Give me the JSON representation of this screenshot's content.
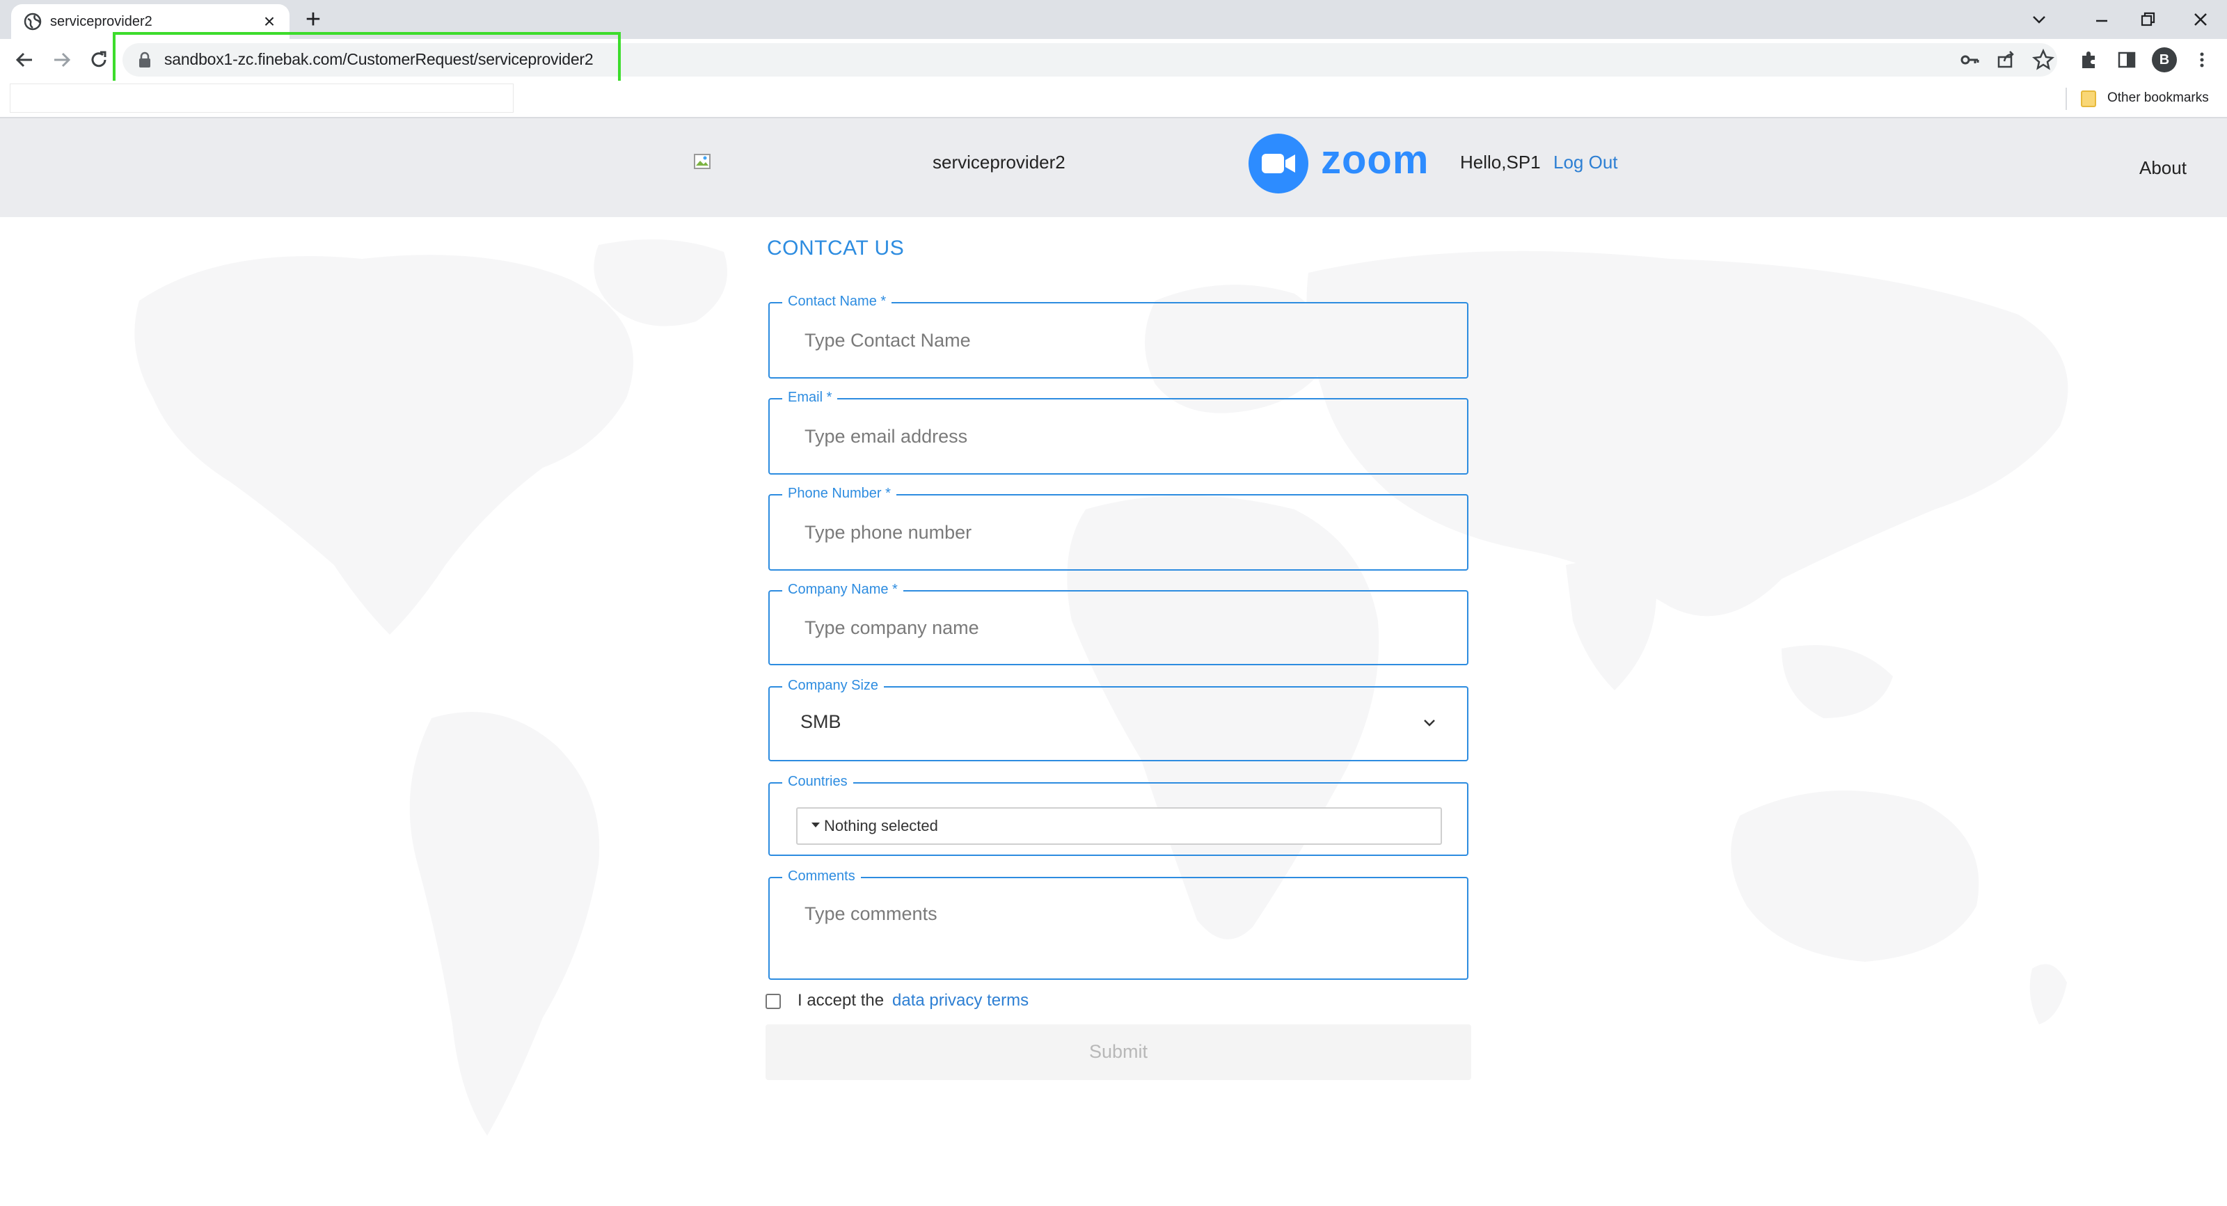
{
  "browser": {
    "tab_title": "serviceprovider2",
    "tab_close": "×",
    "new_tab": "+",
    "url": "sandbox1-zc.finebak.com/CustomerRequest/serviceprovider2",
    "other_bookmarks": "Other bookmarks",
    "profile_initial": "B",
    "highlight_color": "#3ddc2c"
  },
  "header": {
    "site_name": "serviceprovider2",
    "brand": "zoom",
    "greeting": "Hello,SP1",
    "logout": "Log Out",
    "about": "About",
    "brand_color": "#2d8cff"
  },
  "form": {
    "title": "CONTCAT US",
    "accent_color": "#2d8ce0",
    "fields": {
      "contact_name": {
        "label": "Contact Name *",
        "placeholder": "Type Contact Name"
      },
      "email": {
        "label": "Email *",
        "placeholder": "Type email address"
      },
      "phone": {
        "label": "Phone Number *",
        "placeholder": "Type phone number"
      },
      "company_name": {
        "label": "Company Name *",
        "placeholder": "Type company name"
      },
      "company_size": {
        "label": "Company Size",
        "value": "SMB"
      },
      "countries": {
        "label": "Countries",
        "value": "Nothing selected"
      },
      "comments": {
        "label": "Comments",
        "placeholder": "Type comments"
      }
    },
    "accept_text": "I accept the",
    "privacy_link": "data privacy terms",
    "accept_checked": false,
    "submit": "Submit"
  }
}
